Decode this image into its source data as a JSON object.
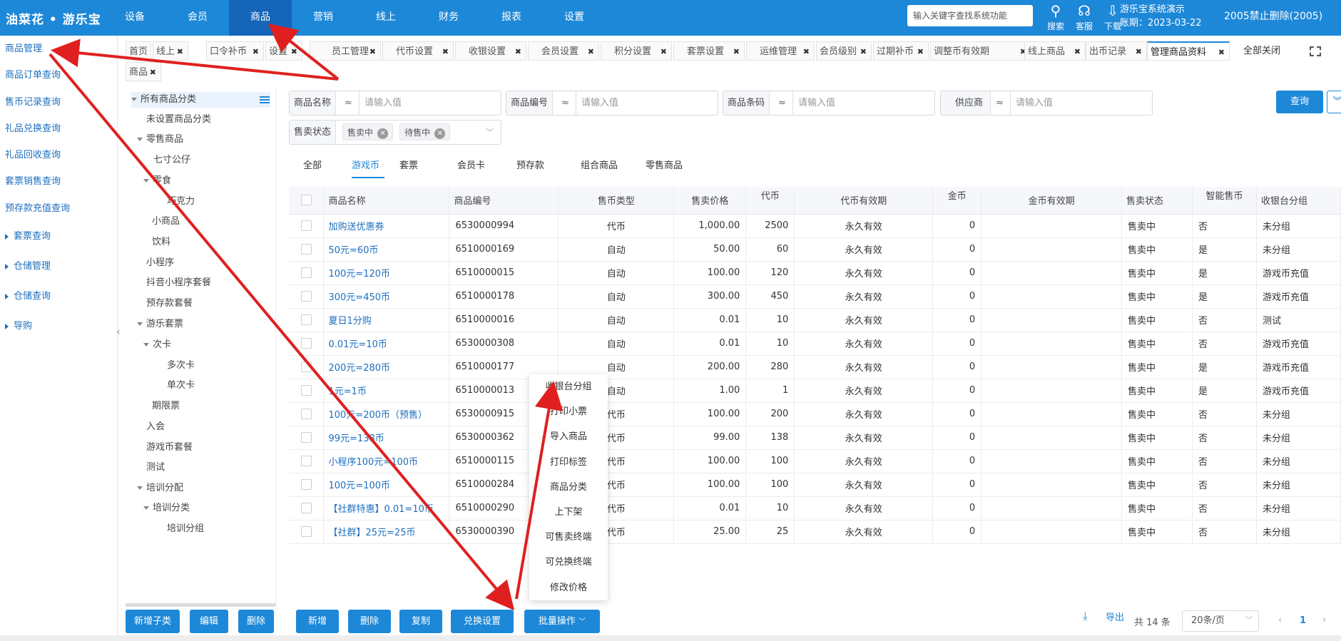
{
  "topbar": {
    "logo": "油菜花 • 游乐宝",
    "nav": [
      "设备",
      "会员",
      "商品",
      "营销",
      "线上",
      "财务",
      "报表",
      "设置"
    ],
    "search_placeholder": "输入关键字查找系统功能",
    "icons": [
      {
        "icon": "search-icon",
        "label": "搜索"
      },
      {
        "icon": "headset-icon",
        "label": "客服"
      },
      {
        "icon": "download-icon",
        "label": "下载"
      }
    ],
    "account_name": "游乐宝系统演示",
    "account_expiry": "账期：2023-03-22",
    "user": "2005禁止删除(2005)"
  },
  "sidebar": {
    "items": [
      "商品管理",
      "商品订单查询",
      "售币记录查询",
      "礼品兑换查询",
      "礼品回收查询",
      "套票销售查询",
      "预存款充值查询"
    ],
    "groups": [
      "套票查询",
      "仓储管理",
      "仓储查询",
      "导购"
    ]
  },
  "tabs": {
    "items": [
      "首页",
      "线上",
      "口令补币",
      "设置",
      "员工管理",
      "代币设置",
      "收银设置",
      "会员设置",
      "积分设置",
      "套票设置",
      "运维管理",
      "会员级别",
      "过期补币",
      "调整币有效期",
      "线上商品",
      "出币记录",
      "管理商品资料",
      "商品"
    ],
    "close_all": "全部关闭"
  },
  "tree": {
    "root": "所有商品分类",
    "nodes": [
      "未设置商品分类",
      "零售商品",
      "七寸公仔",
      "零食",
      "巧克力",
      "小商品",
      "饮料",
      "小程序",
      "抖音小程序套餐",
      "预存款套餐",
      "游乐套票",
      "次卡",
      "多次卡",
      "单次卡",
      "期限票",
      "入会",
      "游戏币套餐",
      "测试",
      "培训分配",
      "培训分类",
      "培训分组"
    ],
    "buttons": [
      "新增子类",
      "编辑",
      "删除"
    ]
  },
  "filters": {
    "fields": [
      {
        "label": "商品名称",
        "op": "≈",
        "placeholder": "请输入值"
      },
      {
        "label": "商品编号",
        "op": "≈",
        "placeholder": "请输入值"
      },
      {
        "label": "商品条码",
        "op": "≈",
        "placeholder": "请输入值"
      },
      {
        "label": "供应商",
        "op": "≈",
        "placeholder": "请输入值"
      }
    ],
    "status_label": "售卖状态",
    "status_tags": [
      "售卖中",
      "待售中"
    ],
    "query": "查询"
  },
  "content_tabs": [
    "全部",
    "游戏币",
    "套票",
    "会员卡",
    "预存款",
    "组合商品",
    "零售商品"
  ],
  "table": {
    "headers": [
      "商品名称",
      "商品编号",
      "售币类型",
      "售卖价格",
      "代币",
      "代币有效期",
      "金币",
      "金币有效期",
      "售卖状态",
      "智能售币",
      "收银台分组"
    ],
    "rows": [
      [
        "加购送优惠券",
        "6530000994",
        "代币",
        "1,000.00",
        "2500",
        "永久有效",
        "0",
        "",
        "售卖中",
        "否",
        "未分组"
      ],
      [
        "50元=60币",
        "6510000169",
        "自动",
        "50.00",
        "60",
        "永久有效",
        "0",
        "",
        "售卖中",
        "是",
        "未分组"
      ],
      [
        "100元=120币",
        "6510000015",
        "自动",
        "100.00",
        "120",
        "永久有效",
        "0",
        "",
        "售卖中",
        "是",
        "游戏币充值"
      ],
      [
        "300元=450币",
        "6510000178",
        "自动",
        "300.00",
        "450",
        "永久有效",
        "0",
        "",
        "售卖中",
        "是",
        "游戏币充值"
      ],
      [
        "夏日1分购",
        "6510000016",
        "自动",
        "0.01",
        "10",
        "永久有效",
        "0",
        "",
        "售卖中",
        "否",
        "测试"
      ],
      [
        "0.01元=10币",
        "6530000308",
        "自动",
        "0.01",
        "10",
        "永久有效",
        "0",
        "",
        "售卖中",
        "否",
        "游戏币充值"
      ],
      [
        "200元=280币",
        "6510000177",
        "自动",
        "200.00",
        "280",
        "永久有效",
        "0",
        "",
        "售卖中",
        "是",
        "游戏币充值"
      ],
      [
        "1元=1币",
        "6510000013",
        "自动",
        "1.00",
        "1",
        "永久有效",
        "0",
        "",
        "售卖中",
        "是",
        "游戏币充值"
      ],
      [
        "100元=200币（预售）",
        "6530000915",
        "代币",
        "100.00",
        "200",
        "永久有效",
        "0",
        "",
        "售卖中",
        "否",
        "未分组"
      ],
      [
        "99元=138币",
        "6530000362",
        "代币",
        "99.00",
        "138",
        "永久有效",
        "0",
        "",
        "售卖中",
        "否",
        "未分组"
      ],
      [
        "小程序100元=100币",
        "6510000115",
        "代币",
        "100.00",
        "100",
        "永久有效",
        "0",
        "",
        "售卖中",
        "否",
        "未分组"
      ],
      [
        "100元=100币",
        "6510000284",
        "代币",
        "100.00",
        "100",
        "永久有效",
        "0",
        "",
        "售卖中",
        "否",
        "未分组"
      ],
      [
        "【社群特惠】0.01=10币",
        "6510000290",
        "代币",
        "0.01",
        "10",
        "永久有效",
        "0",
        "",
        "售卖中",
        "否",
        "未分组"
      ],
      [
        "【社群】25元=25币",
        "6530000390",
        "代币",
        "25.00",
        "25",
        "永久有效",
        "0",
        "",
        "售卖中",
        "否",
        "未分组"
      ]
    ]
  },
  "batch_menu": [
    "收银台分组",
    "打印小票",
    "导入商品",
    "打印标签",
    "商品分类",
    "上下架",
    "可售卖终端",
    "可兑换终端",
    "修改价格"
  ],
  "actions": [
    "新增",
    "删除",
    "复制",
    "兑换设置",
    "批量操作"
  ],
  "footer": {
    "export": "导出",
    "total": "共 14 条",
    "page_size": "20条/页",
    "page": "1"
  },
  "colors": {
    "primary": "#1e88d8",
    "active_nav": "#1565b8",
    "annotation_arrow": "#e02020"
  }
}
